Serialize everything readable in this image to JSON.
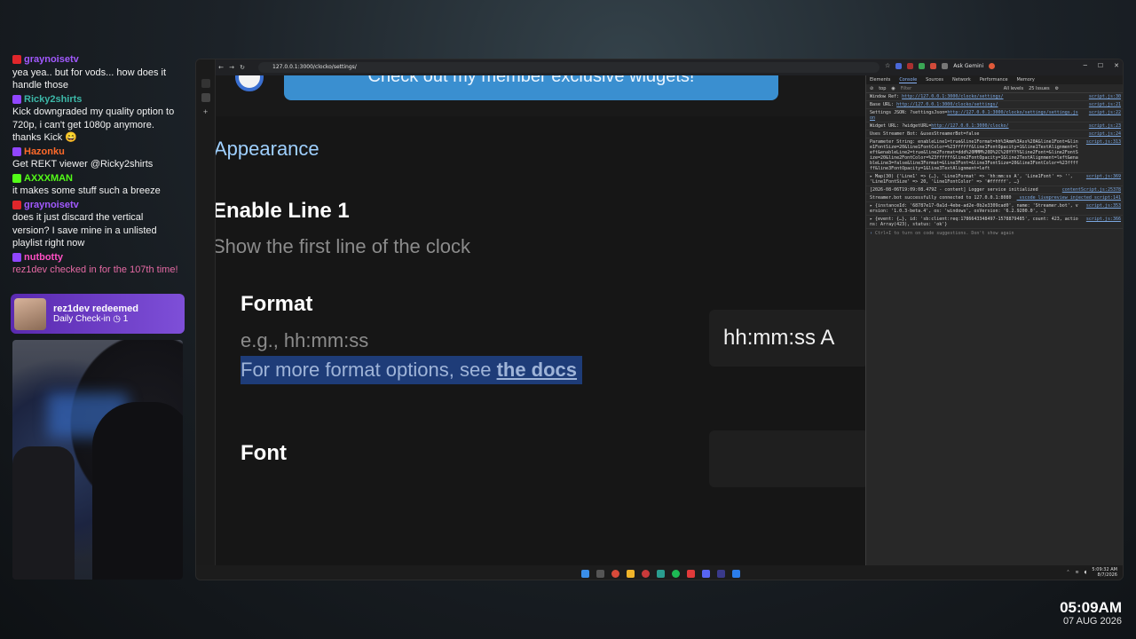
{
  "chat": {
    "messages": [
      {
        "user": "graynoisetv",
        "platform": "youtube",
        "user_color": "#a259ff",
        "text": "yea yea.. but for vods... how does it handle those"
      },
      {
        "user": "Ricky2shirts",
        "platform": "twitch",
        "user_color": "#3cb8a8",
        "text": "Kick downgraded my quality option to 720p, i can't get 1080p anymore. thanks Kick 😄"
      },
      {
        "user": "Hazonku",
        "platform": "twitch",
        "user_color": "#ff6a2a",
        "text": "Get REKT viewer @Ricky2shirts"
      },
      {
        "user": "AXXXMAN",
        "platform": "kick",
        "user_color": "#53fc18",
        "text": "it makes some stuff such a breeze"
      },
      {
        "user": "graynoisetv",
        "platform": "youtube",
        "user_color": "#a259ff",
        "text": "does it just discard the vertical version? I save mine in a unlisted playlist right now"
      },
      {
        "user": "nutbotty",
        "platform": "twitch",
        "user_color": "#ff4fc4",
        "text": "rez1dev checked in for the 107th time!",
        "system": true
      }
    ],
    "redeem": {
      "title": "rez1dev redeemed",
      "subtitle": "Daily Check-in",
      "count": "1"
    }
  },
  "browser": {
    "url": "127.0.0.1:3000/clocko/settings/",
    "ask_gemini": "Ask Gemini"
  },
  "page": {
    "promo_text": "Check out my member exclusive widgets!",
    "section_title": "Appearance",
    "option_title": "Enable Line 1",
    "option_desc": "Show the first line of the clock",
    "format_label": "Format",
    "format_hint": "e.g., hh:mm:ss",
    "format_more_prefix": "For more format options, see ",
    "format_more_link": "the docs",
    "format_value": "hh:mm:ss A",
    "font_label": "Font",
    "font_value": ""
  },
  "devtools": {
    "tabs": [
      "Elements",
      "Console",
      "Sources",
      "Network",
      "Performance",
      "Memory"
    ],
    "active_tab": "Console",
    "context": "top",
    "filter_placeholder": "Filter",
    "levels": "All levels",
    "issues": "25 Issues",
    "logs": [
      {
        "text": "Window Ref: ",
        "link": "http://127.0.0.1:3000/clocko/settings/",
        "src": "script.js:30"
      },
      {
        "text": "Base URL: ",
        "link": "http://127.0.0.1:3000/clocko/settings/",
        "src": "script.js:21"
      },
      {
        "text": "Settings JSON: ?settingsJson=",
        "link": "http://127.0.0.1:3000/clocko/settings/settings.json",
        "src": "script.js:22"
      },
      {
        "text": "Widget URL: ?widgetURL=",
        "link": "http://127.0.0.1:3000/clocko/",
        "src": "script.js:23"
      },
      {
        "text": "Uses Streamer Bot: &usesStreamerBot=false",
        "link": "",
        "src": "script.js:24"
      },
      {
        "text": "Parameter String: enableLine1=true&line1Format=hh%3Amm%3Ass%20A&line1Font=&line1FontSize=20&line1FontColor=%23ffffff&line1FontOpacity=1&line1TextAlignment=left&enableLine2=true&line2Format=ddd%20MMM%20D%2C%20YYYY&line2Font=&line2FontSize=20&line2FontColor=%23ffffff&line2FontOpacity=1&line2TextAlignment=left&enableLine3=false&line3Format=&line3Font=&line3FontSize=20&line3FontColor=%23ffffff&line3FontOpacity=1&line3TextAlignment=left",
        "link": "",
        "src": "script.js:313"
      },
      {
        "text": "▸ Map(30) {'Line1' => {…}, 'Line1Format' => 'hh:mm:ss A', 'Line1Font' => '', 'Line1FontSize' => 20, 'Line1FontColor' => '#ffffff', …}",
        "link": "",
        "src": "script.js:369"
      },
      {
        "text": "[2026-08-06T19:09:08.479Z - content] Logger service initialized",
        "link": "",
        "src": "contentScript.js:25378"
      },
      {
        "text": "Streamer.bot successfully connected to 127.0.0.1:8080",
        "link": "",
        "src": "_vscode_livepreview_injected_script:141"
      },
      {
        "text": "▸ {instanceId: '68787e17-0a1d-4ebe-ad2e-0b2e3309cad0', name: 'Streamer.bot', version: '1.0.3-beta.4', os: 'windows', osVersion: '6.2.9200.0', …}",
        "link": "",
        "src": "script.js:353"
      },
      {
        "text": "▸ {event: {…}, id: 'sb:client:req:1786643348497-1578879485', count: 423, actions: Array(423), status: 'ok'}",
        "link": "",
        "src": "script.js:366"
      }
    ],
    "prompt_hint": "Ctrl+I to turn on code suggestions. Don't show again"
  },
  "taskbar": {
    "time": "5:09:32 AM",
    "date": "8/7/2026"
  },
  "stream_clock": {
    "time": "05:09AM",
    "date": "07 AUG 2026"
  }
}
